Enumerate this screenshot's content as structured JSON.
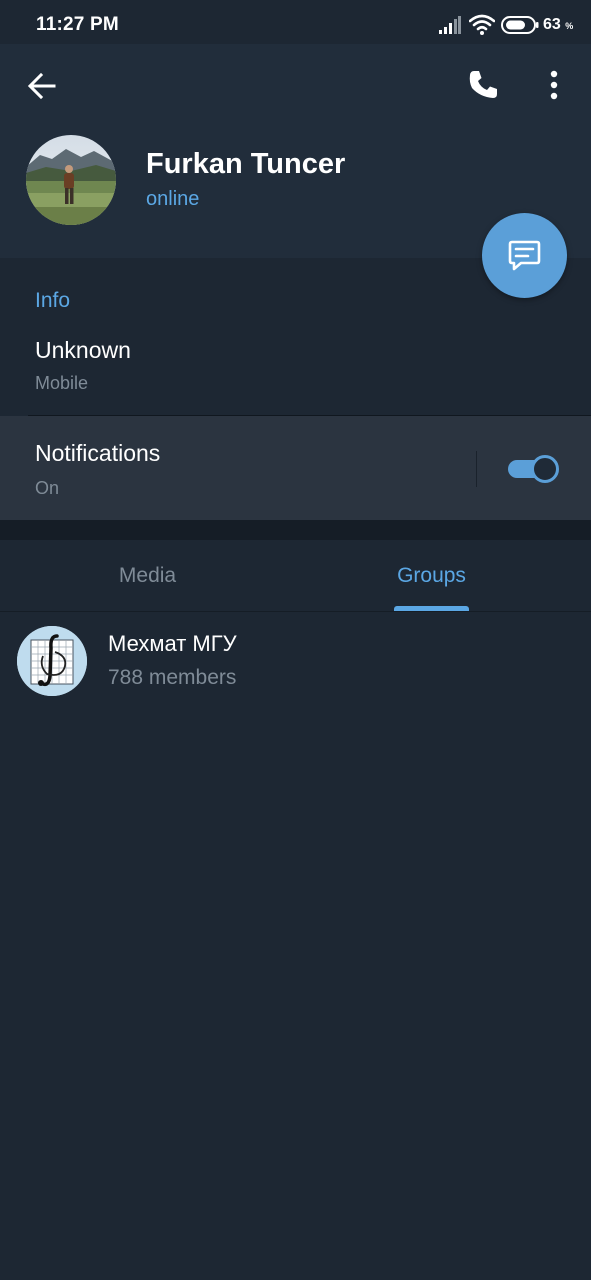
{
  "status_bar": {
    "time": "11:27 PM",
    "battery_percent": "63",
    "battery_unit": "%",
    "icons": [
      "signal-icon",
      "wifi-icon",
      "battery-icon"
    ]
  },
  "header": {
    "back_icon": "arrow-left-icon",
    "call_icon": "phone-icon",
    "more_icon": "more-vertical-icon",
    "name": "Furkan Tuncer",
    "status": "online"
  },
  "fab": {
    "icon": "message-icon"
  },
  "info": {
    "title": "Info",
    "phone_value": "Unknown",
    "phone_label": "Mobile"
  },
  "notifications": {
    "title": "Notifications",
    "state": "On",
    "enabled": true
  },
  "tabs": [
    {
      "label": "Media",
      "active": false
    },
    {
      "label": "Groups",
      "active": true
    }
  ],
  "groups": [
    {
      "name": "Мехмат МГУ",
      "members": "788 members"
    }
  ],
  "colors": {
    "background": "#1d2733",
    "header": "#212d3b",
    "accent": "#5ba7e4",
    "secondary_text": "#7f8b97"
  }
}
